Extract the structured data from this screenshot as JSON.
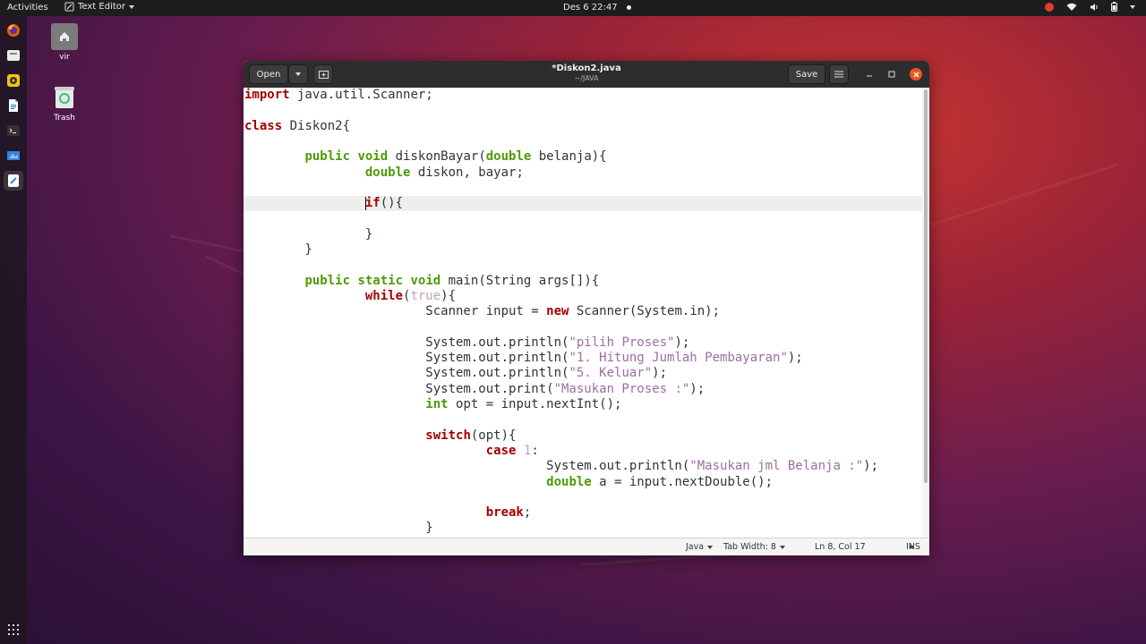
{
  "topbar": {
    "activities": "Activities",
    "app_name": "Text Editor",
    "clock": "Des 6  22:47"
  },
  "desktop": {
    "icons": [
      {
        "label": "vir",
        "icon": "home-folder-icon"
      },
      {
        "label": "Trash",
        "icon": "trash-icon"
      }
    ]
  },
  "dock": {
    "items": [
      "firefox-icon",
      "files-icon",
      "rhythmbox-icon",
      "writer-icon",
      "terminal-icon",
      "screenshot-icon",
      "text-editor-icon"
    ]
  },
  "window": {
    "title": "*Diskon2.java",
    "subtitle": "~/JAVA",
    "open_label": "Open",
    "save_label": "Save"
  },
  "editor": {
    "current_line": 8,
    "lines": [
      [
        [
          "kw",
          "import"
        ],
        [
          "n",
          " java.util.Scanner;"
        ]
      ],
      [],
      [
        [
          "kw",
          "class"
        ],
        [
          "n",
          " Diskon2{"
        ]
      ],
      [],
      [
        [
          "n",
          "        "
        ],
        [
          "ty",
          "public"
        ],
        [
          "n",
          " "
        ],
        [
          "ty",
          "void"
        ],
        [
          "n",
          " diskonBayar("
        ],
        [
          "ty",
          "double"
        ],
        [
          "n",
          " belanja){"
        ]
      ],
      [
        [
          "n",
          "                "
        ],
        [
          "ty",
          "double"
        ],
        [
          "n",
          " diskon, bayar;"
        ]
      ],
      [],
      [
        [
          "n",
          "                "
        ],
        [
          "kw",
          "if"
        ],
        [
          "n",
          "(){"
        ]
      ],
      [],
      [
        [
          "n",
          "                }"
        ]
      ],
      [
        [
          "n",
          "        }"
        ]
      ],
      [],
      [
        [
          "n",
          "        "
        ],
        [
          "ty",
          "public"
        ],
        [
          "n",
          " "
        ],
        [
          "ty",
          "static"
        ],
        [
          "n",
          " "
        ],
        [
          "ty",
          "void"
        ],
        [
          "n",
          " main(String args[]){"
        ]
      ],
      [
        [
          "n",
          "                "
        ],
        [
          "kw",
          "while"
        ],
        [
          "n",
          "("
        ],
        [
          "nu",
          "true"
        ],
        [
          "n",
          "){"
        ]
      ],
      [
        [
          "n",
          "                        Scanner input = "
        ],
        [
          "kw",
          "new"
        ],
        [
          "n",
          " Scanner(System.in);"
        ]
      ],
      [],
      [
        [
          "n",
          "                        System.out.println("
        ],
        [
          "st",
          "\"pilih Proses\""
        ],
        [
          "n",
          ");"
        ]
      ],
      [
        [
          "n",
          "                        System.out.println("
        ],
        [
          "st",
          "\"1. Hitung Jumlah Pembayaran\""
        ],
        [
          "n",
          ");"
        ]
      ],
      [
        [
          "n",
          "                        System.out.println("
        ],
        [
          "st",
          "\"5. Keluar\""
        ],
        [
          "n",
          ");"
        ]
      ],
      [
        [
          "n",
          "                        System.out.print("
        ],
        [
          "st",
          "\"Masukan Proses :\""
        ],
        [
          "n",
          ");"
        ]
      ],
      [
        [
          "n",
          "                        "
        ],
        [
          "ty",
          "int"
        ],
        [
          "n",
          " opt = input.nextInt();"
        ]
      ],
      [],
      [
        [
          "n",
          "                        "
        ],
        [
          "kw",
          "switch"
        ],
        [
          "n",
          "(opt){"
        ]
      ],
      [
        [
          "n",
          "                                "
        ],
        [
          "kw",
          "case"
        ],
        [
          "n",
          " "
        ],
        [
          "nu",
          "1"
        ],
        [
          "n",
          ":"
        ]
      ],
      [
        [
          "n",
          "                                        System.out.println("
        ],
        [
          "st",
          "\"Masukan jml Belanja :\""
        ],
        [
          "n",
          ");"
        ]
      ],
      [
        [
          "n",
          "                                        "
        ],
        [
          "ty",
          "double"
        ],
        [
          "n",
          " a = input.nextDouble();"
        ]
      ],
      [],
      [
        [
          "n",
          "                                "
        ],
        [
          "kw",
          "break"
        ],
        [
          "n",
          ";"
        ]
      ],
      [
        [
          "n",
          "                        }"
        ]
      ]
    ]
  },
  "statusbar": {
    "language": "Java",
    "tab_width": "Tab Width: 8",
    "position": "Ln 8, Col 17",
    "mode": "INS"
  }
}
